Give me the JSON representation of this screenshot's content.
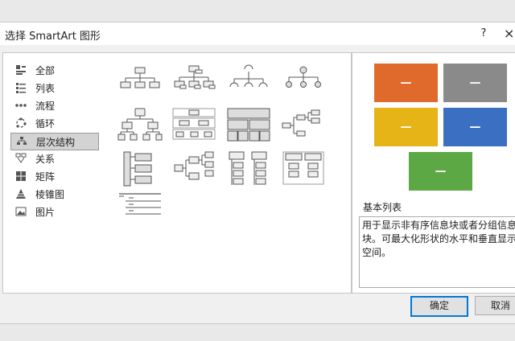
{
  "window": {
    "title": "选择 SmartArt 图形",
    "help_symbol": "?",
    "close_symbol": "×"
  },
  "categories": [
    {
      "label": "全部",
      "icon": "all-icon",
      "selected": false
    },
    {
      "label": "列表",
      "icon": "list-icon",
      "selected": false
    },
    {
      "label": "流程",
      "icon": "process-icon",
      "selected": false
    },
    {
      "label": "循环",
      "icon": "cycle-icon",
      "selected": false
    },
    {
      "label": "层次结构",
      "icon": "hierarchy-icon",
      "selected": true
    },
    {
      "label": "关系",
      "icon": "relationship-icon",
      "selected": false
    },
    {
      "label": "矩阵",
      "icon": "matrix-icon",
      "selected": false
    },
    {
      "label": "棱锥图",
      "icon": "pyramid-icon",
      "selected": false
    },
    {
      "label": "图片",
      "icon": "picture-icon",
      "selected": false
    }
  ],
  "preview": {
    "name": "基本列表",
    "description": "用于显示非有序信息块或者分组信息块。可最大化形状的水平和垂直显示空间。",
    "colors": {
      "orange": "#e06a2c",
      "gray": "#8a8a8a",
      "yellow": "#e7b418",
      "blue": "#3a6fc1",
      "green": "#5ba845"
    }
  },
  "buttons": {
    "ok": "确定",
    "cancel": "取消"
  }
}
